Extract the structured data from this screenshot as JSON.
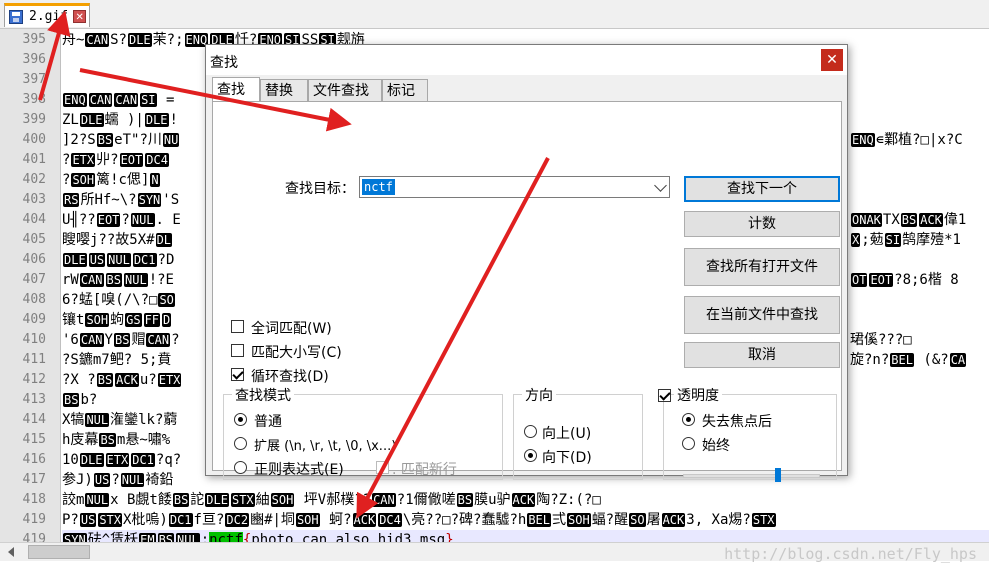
{
  "tab": {
    "name": "2.gif"
  },
  "editor": {
    "lines": [
      {
        "n": "395",
        "parts": [
          [
            "t",
            "舟~"
          ],
          [
            "c",
            "CAN"
          ],
          [
            "t",
            "S?"
          ],
          [
            "c",
            "DLE"
          ],
          [
            "t",
            "茉?;"
          ],
          [
            "c",
            "ENQ"
          ],
          [
            "c",
            "DLE"
          ],
          [
            "t",
            "忏?"
          ],
          [
            "c",
            "ENQ"
          ],
          [
            "c",
            "SI"
          ],
          [
            "t",
            "SS"
          ],
          [
            "c",
            "SI"
          ],
          [
            "t",
            "觌旃"
          ]
        ]
      },
      {
        "n": "396",
        "parts": []
      },
      {
        "n": "397",
        "parts": []
      },
      {
        "n": "398",
        "parts": [
          [
            "c",
            "ENQ"
          ],
          [
            "c",
            "CAN"
          ],
          [
            "c",
            "CAN"
          ],
          [
            "c",
            "SI"
          ],
          [
            "t",
            " ="
          ]
        ]
      },
      {
        "n": "399",
        "parts": [
          [
            "t",
            "ZL"
          ],
          [
            "c",
            "DLE"
          ],
          [
            "t",
            "蠕 )|"
          ],
          [
            "c",
            "DLE"
          ],
          [
            "t",
            "!"
          ]
        ]
      },
      {
        "n": "400",
        "parts": [
          [
            "t",
            "]2?S"
          ],
          [
            "c",
            "BS"
          ],
          [
            "t",
            "eT\"?川"
          ],
          [
            "c",
            "NU"
          ]
        ]
      },
      {
        "n": "401",
        "parts": [
          [
            "t",
            "?"
          ],
          [
            "c",
            "ETX"
          ],
          [
            "t",
            "丱?"
          ],
          [
            "c",
            "EOT"
          ],
          [
            "c",
            "DC4"
          ]
        ]
      },
      {
        "n": "402",
        "parts": [
          [
            "t",
            "  ?"
          ],
          [
            "c",
            "SOH"
          ],
          [
            "t",
            "篱!c偲]"
          ],
          [
            "c",
            "N"
          ]
        ]
      },
      {
        "n": "403",
        "parts": [
          [
            "c",
            "RS"
          ],
          [
            "t",
            "所Hf~\\?"
          ],
          [
            "c",
            "SYN"
          ],
          [
            "t",
            "'S"
          ]
        ]
      },
      {
        "n": "404",
        "parts": [
          [
            "t",
            "U╢??"
          ],
          [
            "c",
            "EOT"
          ],
          [
            "t",
            "?"
          ],
          [
            "c",
            "NUL"
          ],
          [
            "t",
            ". E"
          ]
        ]
      },
      {
        "n": "405",
        "parts": [
          [
            "t",
            "瞍嘤j??故5X#"
          ],
          [
            "c",
            "DL"
          ]
        ]
      },
      {
        "n": "406",
        "parts": [
          [
            "c",
            "DLE"
          ],
          [
            "c",
            "US"
          ],
          [
            "c",
            "NUL"
          ],
          [
            "c",
            "DC1"
          ],
          [
            "t",
            "?D"
          ]
        ]
      },
      {
        "n": "407",
        "parts": [
          [
            "t",
            "rW"
          ],
          [
            "c",
            "CAN"
          ],
          [
            "c",
            "BS"
          ],
          [
            "c",
            "NUL"
          ],
          [
            "t",
            "!?E"
          ]
        ]
      },
      {
        "n": "408",
        "parts": [
          [
            "t",
            "6?蜢[嗅(/\\?□"
          ],
          [
            "c",
            "SO"
          ]
        ]
      },
      {
        "n": "409",
        "parts": [
          [
            "t",
            "镶t"
          ],
          [
            "c",
            "SOH"
          ],
          [
            "t",
            "蚼"
          ],
          [
            "c",
            "GS"
          ],
          [
            "c",
            "FF"
          ],
          [
            "c",
            "D"
          ]
        ]
      },
      {
        "n": "410",
        "parts": [
          [
            "t",
            "'6"
          ],
          [
            "c",
            "CAN"
          ],
          [
            "t",
            "Y"
          ],
          [
            "c",
            "BS"
          ],
          [
            "t",
            "赗"
          ],
          [
            "c",
            "CAN"
          ],
          [
            "t",
            "?"
          ]
        ]
      },
      {
        "n": "411",
        "parts": [
          [
            "t",
            "?S鑣m7鲃?  5;賁"
          ]
        ]
      },
      {
        "n": "412",
        "parts": [
          [
            "t",
            "?X ?"
          ],
          [
            "c",
            "BS"
          ],
          [
            "c",
            "ACK"
          ],
          [
            "t",
            "u?"
          ],
          [
            "c",
            "ETX"
          ]
        ]
      },
      {
        "n": "413",
        "parts": [
          [
            "c",
            "BS"
          ],
          [
            "t",
            "b?"
          ]
        ]
      },
      {
        "n": "414",
        "parts": [
          [
            "t",
            "X犒"
          ],
          [
            "c",
            "NUL"
          ],
          [
            "t",
            "潅鑾lk?藭"
          ]
        ]
      },
      {
        "n": "415",
        "parts": [
          [
            "t",
            "h庋幕"
          ],
          [
            "c",
            "BS"
          ],
          [
            "t",
            "m悬~嘯%"
          ]
        ]
      },
      {
        "n": "416",
        "parts": [
          [
            "t",
            "10"
          ],
          [
            "c",
            "DLE"
          ],
          [
            "c",
            "ETX"
          ],
          [
            "c",
            "DC1"
          ],
          [
            "t",
            "?q?"
          ]
        ]
      },
      {
        "n": "417",
        "parts": [
          [
            "t",
            "参J)"
          ],
          [
            "c",
            "US"
          ],
          [
            "t",
            "?"
          ],
          [
            "c",
            "NUL"
          ],
          [
            "t",
            "裿鉛"
          ]
        ]
      },
      {
        "n": "418",
        "parts": [
          [
            "t",
            "詨m"
          ],
          [
            "c",
            "NUL"
          ],
          [
            "t",
            "x  B覷t餧"
          ],
          [
            "c",
            "BS"
          ],
          [
            "t",
            "詑"
          ],
          [
            "c",
            "DLE"
          ],
          [
            "c",
            "STX"
          ],
          [
            "t",
            "紬"
          ],
          [
            "c",
            "SOH"
          ],
          [
            "t",
            "  坪V郝樸?1"
          ],
          [
            "c",
            "CAN"
          ],
          [
            "t",
            "?1儞僘嗟"
          ],
          [
            "c",
            "BS"
          ],
          [
            "t",
            "膜u驴"
          ],
          [
            "c",
            "ACK"
          ],
          [
            "t",
            "陶?Z:(?□"
          ]
        ]
      },
      {
        "n": "419",
        "parts": [
          [
            "t",
            "P?"
          ],
          [
            "c",
            "US"
          ],
          [
            "c",
            "STX"
          ],
          [
            "t",
            "X枇嗚)"
          ],
          [
            "c",
            "DC1"
          ],
          [
            "t",
            "f亘?"
          ],
          [
            "c",
            "DC2"
          ],
          [
            "t",
            "豳#|垌"
          ],
          [
            "c",
            "SOH"
          ],
          [
            "t",
            "  蚵?"
          ],
          [
            "c",
            "ACK"
          ],
          [
            "c",
            "DC4"
          ],
          [
            "t",
            "\\亮??□?碑?蠢驉?h"
          ],
          [
            "c",
            "BEL"
          ],
          [
            "t",
            "弍"
          ],
          [
            "c",
            "SOH"
          ],
          [
            "t",
            "蝠?醒"
          ],
          [
            "c",
            "SO"
          ],
          [
            "t",
            "屠"
          ],
          [
            "c",
            "ACK"
          ],
          [
            "t",
            "3, Xa焬?"
          ],
          [
            "c",
            "STX"
          ]
        ]
      },
      {
        "n": "419",
        "cur": true,
        "parts": [
          [
            "c",
            "SYN"
          ],
          [
            "t",
            "砝^赁枖"
          ],
          [
            "c",
            "EM"
          ],
          [
            "c",
            "BS"
          ],
          [
            "c",
            "NUL"
          ],
          [
            "t",
            ";"
          ],
          [
            "h",
            "nctf"
          ],
          [
            "b",
            "{"
          ],
          [
            "t",
            "photo_can_also_hid3_msg"
          ],
          [
            "b",
            "}"
          ]
        ]
      }
    ],
    "right_fragments": [
      {
        "row": 5,
        "parts": [
          [
            "c",
            "ENQ"
          ],
          [
            "t",
            "∊鄴植?□|x?C"
          ]
        ]
      },
      {
        "row": 9,
        "parts": [
          [
            "c",
            "ONAK"
          ],
          [
            "t",
            "TX"
          ],
          [
            "c",
            "BS"
          ],
          [
            "c",
            "ACK"
          ],
          [
            "t",
            "偉1"
          ]
        ]
      },
      {
        "row": 10,
        "parts": [
          [
            "c",
            "X"
          ],
          [
            "t",
            ";葂"
          ],
          [
            "c",
            "SI"
          ],
          [
            "t",
            "鹄摩殪*1"
          ]
        ]
      },
      {
        "row": 12,
        "parts": [
          [
            "c",
            "OT"
          ],
          [
            "c",
            "EOT"
          ],
          [
            "t",
            "?8;6楷  8"
          ]
        ]
      },
      {
        "row": 15,
        "parts": [
          [
            "t",
            "珺傒???□"
          ]
        ]
      },
      {
        "row": 16,
        "parts": [
          [
            "t",
            "旋?n?"
          ],
          [
            "c",
            "BEL"
          ],
          [
            "t",
            " (&?"
          ],
          [
            "c",
            "CA"
          ]
        ]
      }
    ]
  },
  "watermark": "http://blog.csdn.net/Fly_hps",
  "dialog": {
    "title": "查找",
    "close": "✕",
    "tabs": [
      "查找",
      "替换",
      "文件查找",
      "标记"
    ],
    "find_label": "查找目标：",
    "find_value": "nctf",
    "buttons": [
      "查找下一个",
      "计数",
      "查找所有打开文件",
      "在当前文件中查找",
      "取消"
    ],
    "options": {
      "whole_word": "全词匹配(W)",
      "match_case": "匹配大小写(C)",
      "wrap": "循环查找(D)"
    },
    "search_mode": {
      "title": "查找模式",
      "normal": "普通",
      "extended": "扩展 (\\n, \\r, \\t, \\0, \\x...)",
      "regex": "正则表达式(E)",
      "newline": ". 匹配新行"
    },
    "direction": {
      "title": "方向",
      "up": "向上(U)",
      "down": "向下(D)"
    },
    "transparency": {
      "title": "透明度",
      "on_lose_focus": "失去焦点后",
      "always": "始终",
      "level": 0.7
    }
  }
}
